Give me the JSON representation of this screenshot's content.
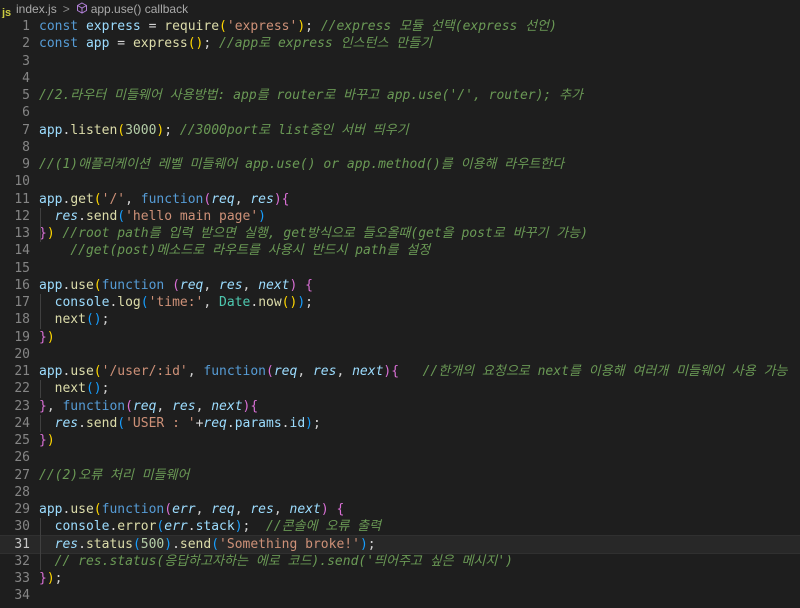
{
  "breadcrumb": {
    "file_icon": "js",
    "file": "index.js",
    "separator": ">",
    "symbol": "app.use() callback"
  },
  "lines": [
    {
      "n": "1",
      "tokens": [
        [
          "kw",
          "const "
        ],
        [
          "var",
          "express"
        ],
        [
          "pun",
          " = "
        ],
        [
          "fn",
          "require"
        ],
        [
          "br1",
          "("
        ],
        [
          "str",
          "'express'"
        ],
        [
          "br1",
          ")"
        ],
        [
          "pun",
          "; "
        ],
        [
          "cm",
          "//express 모듈 선택(express 선언)"
        ]
      ]
    },
    {
      "n": "2",
      "tokens": [
        [
          "kw",
          "const "
        ],
        [
          "var",
          "app"
        ],
        [
          "pun",
          " = "
        ],
        [
          "fn",
          "express"
        ],
        [
          "br1",
          "()"
        ],
        [
          "pun",
          "; "
        ],
        [
          "cm",
          "//app로 express 인스턴스 만들기"
        ]
      ]
    },
    {
      "n": "3",
      "tokens": []
    },
    {
      "n": "4",
      "tokens": []
    },
    {
      "n": "5",
      "tokens": [
        [
          "cm",
          "//2.라우터 미들웨어 사용방법: app를 router로 바꾸고 app.use('/', router); 추가"
        ]
      ]
    },
    {
      "n": "6",
      "tokens": []
    },
    {
      "n": "7",
      "tokens": [
        [
          "var",
          "app"
        ],
        [
          "pun",
          "."
        ],
        [
          "fn",
          "listen"
        ],
        [
          "br1",
          "("
        ],
        [
          "num",
          "3000"
        ],
        [
          "br1",
          ")"
        ],
        [
          "pun",
          "; "
        ],
        [
          "cm",
          "//3000port로 list중인 서버 띄우기"
        ]
      ]
    },
    {
      "n": "8",
      "tokens": []
    },
    {
      "n": "9",
      "tokens": [
        [
          "cm",
          "//(1)애플리케이션 레벨 미들웨어 app.use() or app.method()를 이용해 라우트한다"
        ]
      ]
    },
    {
      "n": "10",
      "tokens": []
    },
    {
      "n": "11",
      "tokens": [
        [
          "var",
          "app"
        ],
        [
          "pun",
          "."
        ],
        [
          "fn",
          "get"
        ],
        [
          "br1",
          "("
        ],
        [
          "str",
          "'/'"
        ],
        [
          "pun",
          ", "
        ],
        [
          "kw",
          "function"
        ],
        [
          "br2",
          "("
        ],
        [
          "par",
          "req"
        ],
        [
          "pun",
          ", "
        ],
        [
          "par",
          "res"
        ],
        [
          "br2",
          ")"
        ],
        [
          "br2",
          "{"
        ]
      ]
    },
    {
      "n": "12",
      "tokens": [
        [
          "pun",
          "  "
        ],
        [
          "par",
          "res"
        ],
        [
          "pun",
          "."
        ],
        [
          "fn",
          "send"
        ],
        [
          "br3",
          "("
        ],
        [
          "str",
          "'hello main page'"
        ],
        [
          "br3",
          ")"
        ]
      ]
    },
    {
      "n": "13",
      "tokens": [
        [
          "br2",
          "}"
        ],
        [
          "br1",
          ")"
        ],
        [
          "pun",
          " "
        ],
        [
          "cm",
          "//root path를 입력 받으면 실행, get방식으로 들오올때(get을 post로 바꾸기 가능)"
        ]
      ]
    },
    {
      "n": "14",
      "tokens": [
        [
          "pun",
          "    "
        ],
        [
          "cm",
          "//get(post)메소드로 라우트를 사용시 반드시 path를 설정"
        ]
      ]
    },
    {
      "n": "15",
      "tokens": []
    },
    {
      "n": "16",
      "tokens": [
        [
          "var",
          "app"
        ],
        [
          "pun",
          "."
        ],
        [
          "fn",
          "use"
        ],
        [
          "br1",
          "("
        ],
        [
          "kw",
          "function "
        ],
        [
          "br2",
          "("
        ],
        [
          "par",
          "req"
        ],
        [
          "pun",
          ", "
        ],
        [
          "par",
          "res"
        ],
        [
          "pun",
          ", "
        ],
        [
          "par",
          "next"
        ],
        [
          "br2",
          ")"
        ],
        [
          "pun",
          " "
        ],
        [
          "br2",
          "{"
        ]
      ]
    },
    {
      "n": "17",
      "tokens": [
        [
          "pun",
          "  "
        ],
        [
          "var",
          "console"
        ],
        [
          "pun",
          "."
        ],
        [
          "fn",
          "log"
        ],
        [
          "br3",
          "("
        ],
        [
          "str",
          "'time:'"
        ],
        [
          "pun",
          ", "
        ],
        [
          "cls",
          "Date"
        ],
        [
          "pun",
          "."
        ],
        [
          "fn",
          "now"
        ],
        [
          "br1",
          "()"
        ],
        [
          "br3",
          ")"
        ],
        [
          "pun",
          ";"
        ]
      ]
    },
    {
      "n": "18",
      "tokens": [
        [
          "pun",
          "  "
        ],
        [
          "fn",
          "next"
        ],
        [
          "br3",
          "()"
        ],
        [
          "pun",
          ";"
        ]
      ]
    },
    {
      "n": "19",
      "tokens": [
        [
          "br2",
          "}"
        ],
        [
          "br1",
          ")"
        ]
      ]
    },
    {
      "n": "20",
      "tokens": []
    },
    {
      "n": "21",
      "tokens": [
        [
          "var",
          "app"
        ],
        [
          "pun",
          "."
        ],
        [
          "fn",
          "use"
        ],
        [
          "br1",
          "("
        ],
        [
          "str",
          "'/user/:id'"
        ],
        [
          "pun",
          ", "
        ],
        [
          "kw",
          "function"
        ],
        [
          "br2",
          "("
        ],
        [
          "par",
          "req"
        ],
        [
          "pun",
          ", "
        ],
        [
          "par",
          "res"
        ],
        [
          "pun",
          ", "
        ],
        [
          "par",
          "next"
        ],
        [
          "br2",
          ")"
        ],
        [
          "br2",
          "{"
        ],
        [
          "pun",
          "   "
        ],
        [
          "cm",
          "//한개의 요청으로 next를 이용해 여러개 미들웨어 사용 가능"
        ]
      ]
    },
    {
      "n": "22",
      "tokens": [
        [
          "pun",
          "  "
        ],
        [
          "fn",
          "next"
        ],
        [
          "br3",
          "()"
        ],
        [
          "pun",
          ";"
        ]
      ]
    },
    {
      "n": "23",
      "tokens": [
        [
          "br2",
          "}"
        ],
        [
          "pun",
          ", "
        ],
        [
          "kw",
          "function"
        ],
        [
          "br2",
          "("
        ],
        [
          "par",
          "req"
        ],
        [
          "pun",
          ", "
        ],
        [
          "par",
          "res"
        ],
        [
          "pun",
          ", "
        ],
        [
          "par",
          "next"
        ],
        [
          "br2",
          ")"
        ],
        [
          "br2",
          "{"
        ]
      ]
    },
    {
      "n": "24",
      "tokens": [
        [
          "pun",
          "  "
        ],
        [
          "par",
          "res"
        ],
        [
          "pun",
          "."
        ],
        [
          "fn",
          "send"
        ],
        [
          "br3",
          "("
        ],
        [
          "str",
          "'USER : '"
        ],
        [
          "pun",
          "+"
        ],
        [
          "par",
          "req"
        ],
        [
          "pun",
          "."
        ],
        [
          "var",
          "params"
        ],
        [
          "pun",
          "."
        ],
        [
          "var",
          "id"
        ],
        [
          "br3",
          ")"
        ],
        [
          "pun",
          ";"
        ]
      ]
    },
    {
      "n": "25",
      "tokens": [
        [
          "br2",
          "}"
        ],
        [
          "br1",
          ")"
        ]
      ]
    },
    {
      "n": "26",
      "tokens": []
    },
    {
      "n": "27",
      "tokens": [
        [
          "cm",
          "//(2)오류 처리 미들웨어"
        ]
      ]
    },
    {
      "n": "28",
      "tokens": []
    },
    {
      "n": "29",
      "tokens": [
        [
          "var",
          "app"
        ],
        [
          "pun",
          "."
        ],
        [
          "fn",
          "use"
        ],
        [
          "br1",
          "("
        ],
        [
          "kw",
          "function"
        ],
        [
          "br2",
          "("
        ],
        [
          "par",
          "err"
        ],
        [
          "pun",
          ", "
        ],
        [
          "par",
          "req"
        ],
        [
          "pun",
          ", "
        ],
        [
          "par",
          "res"
        ],
        [
          "pun",
          ", "
        ],
        [
          "par",
          "next"
        ],
        [
          "br2",
          ")"
        ],
        [
          "pun",
          " "
        ],
        [
          "br2",
          "{"
        ]
      ]
    },
    {
      "n": "30",
      "tokens": [
        [
          "pun",
          "  "
        ],
        [
          "var",
          "console"
        ],
        [
          "pun",
          "."
        ],
        [
          "fn",
          "error"
        ],
        [
          "br3",
          "("
        ],
        [
          "par",
          "err"
        ],
        [
          "pun",
          "."
        ],
        [
          "var",
          "stack"
        ],
        [
          "br3",
          ")"
        ],
        [
          "pun",
          ";  "
        ],
        [
          "cm",
          "//콘솔에 오류 출력"
        ]
      ]
    },
    {
      "n": "31",
      "active": true,
      "tokens": [
        [
          "pun",
          "  "
        ],
        [
          "par",
          "res"
        ],
        [
          "pun",
          "."
        ],
        [
          "fn",
          "status"
        ],
        [
          "br3",
          "("
        ],
        [
          "num",
          "500"
        ],
        [
          "br3",
          ")"
        ],
        [
          "pun",
          "."
        ],
        [
          "fn",
          "send"
        ],
        [
          "br3",
          "("
        ],
        [
          "str",
          "'Something broke!'"
        ],
        [
          "br3",
          ")"
        ],
        [
          "pun",
          ";"
        ]
      ]
    },
    {
      "n": "32",
      "tokens": [
        [
          "pun",
          "  "
        ],
        [
          "cm",
          "// res.status(응답하고자하는 에로 코드).send('띄어주고 싶은 메시지')"
        ]
      ]
    },
    {
      "n": "33",
      "tokens": [
        [
          "br2",
          "}"
        ],
        [
          "br1",
          ")"
        ],
        [
          "pun",
          ";"
        ]
      ]
    },
    {
      "n": "34",
      "tokens": []
    }
  ],
  "colors": {
    "background": "#1e1e1e",
    "keyword": "#569cd6",
    "variable": "#9cdcfe",
    "function": "#dcdcaa",
    "string": "#ce9178",
    "number": "#b5cea8",
    "comment": "#6a9955"
  }
}
